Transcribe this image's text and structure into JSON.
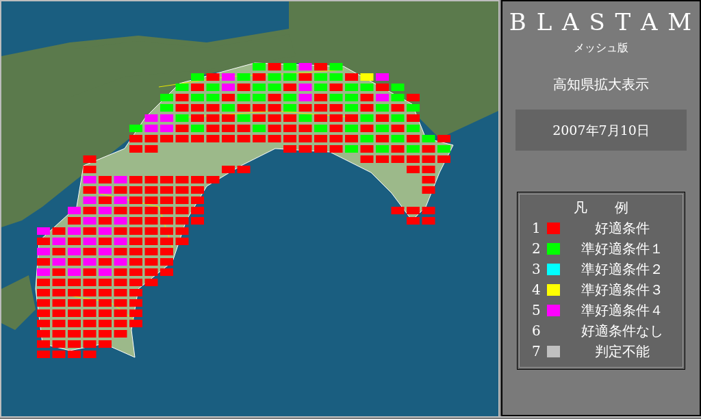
{
  "panel": {
    "title": "B L A S T A M",
    "subtitle": "メッシュ版",
    "region": "高知県拡大表示",
    "date": "2007年7月10日"
  },
  "legend": {
    "title": "凡　　例",
    "items": [
      {
        "number": "1",
        "label": "好適条件",
        "color": "#ff0000"
      },
      {
        "number": "2",
        "label": "準好適条件１",
        "color": "#00ff00"
      },
      {
        "number": "3",
        "label": "準好適条件２",
        "color": "#00ffff"
      },
      {
        "number": "4",
        "label": "準好適条件３",
        "color": "#ffff00"
      },
      {
        "number": "5",
        "label": "準好適条件４",
        "color": "#ff00ff"
      },
      {
        "number": "6",
        "label": "好適条件なし"
      },
      {
        "number": "7",
        "label": "判定不能",
        "color": "#c0c0c0"
      }
    ]
  }
}
